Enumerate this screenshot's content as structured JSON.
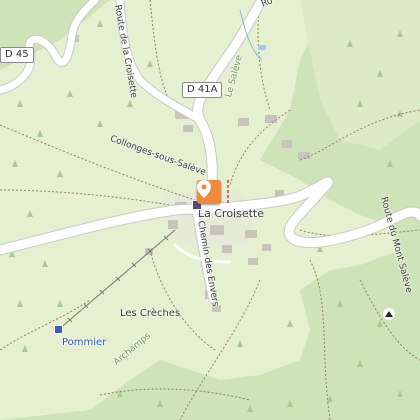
{
  "map": {
    "labels": {
      "d45": "D 45",
      "d41a": "D 41A",
      "le_saleve": "Le Salève",
      "route_de_la_croisette": "Route de la Croisette",
      "collonges": "Collonges-sous-Salève",
      "la_croisette": "La Croisette",
      "chemin_des_envers": "Chemin des Envers",
      "route_du_mont_saleve": "Route du Mont Salève",
      "les_creches": "Les Crèches",
      "pommier": "Pommier",
      "archamps": "Archamps",
      "route_top": "Ro"
    },
    "icons": {
      "location_marker": "map-pin-icon",
      "peak": "peak-icon",
      "bus_stop": "bus-stop-icon",
      "parking": "parking-icon"
    },
    "colors": {
      "forest": "#cfe3b8",
      "meadow": "#e4f0cf",
      "road": "#ffffff",
      "road_outline": "#c9c9c9",
      "trail": "#9a7a5a",
      "marker": "#f08a3a"
    }
  }
}
